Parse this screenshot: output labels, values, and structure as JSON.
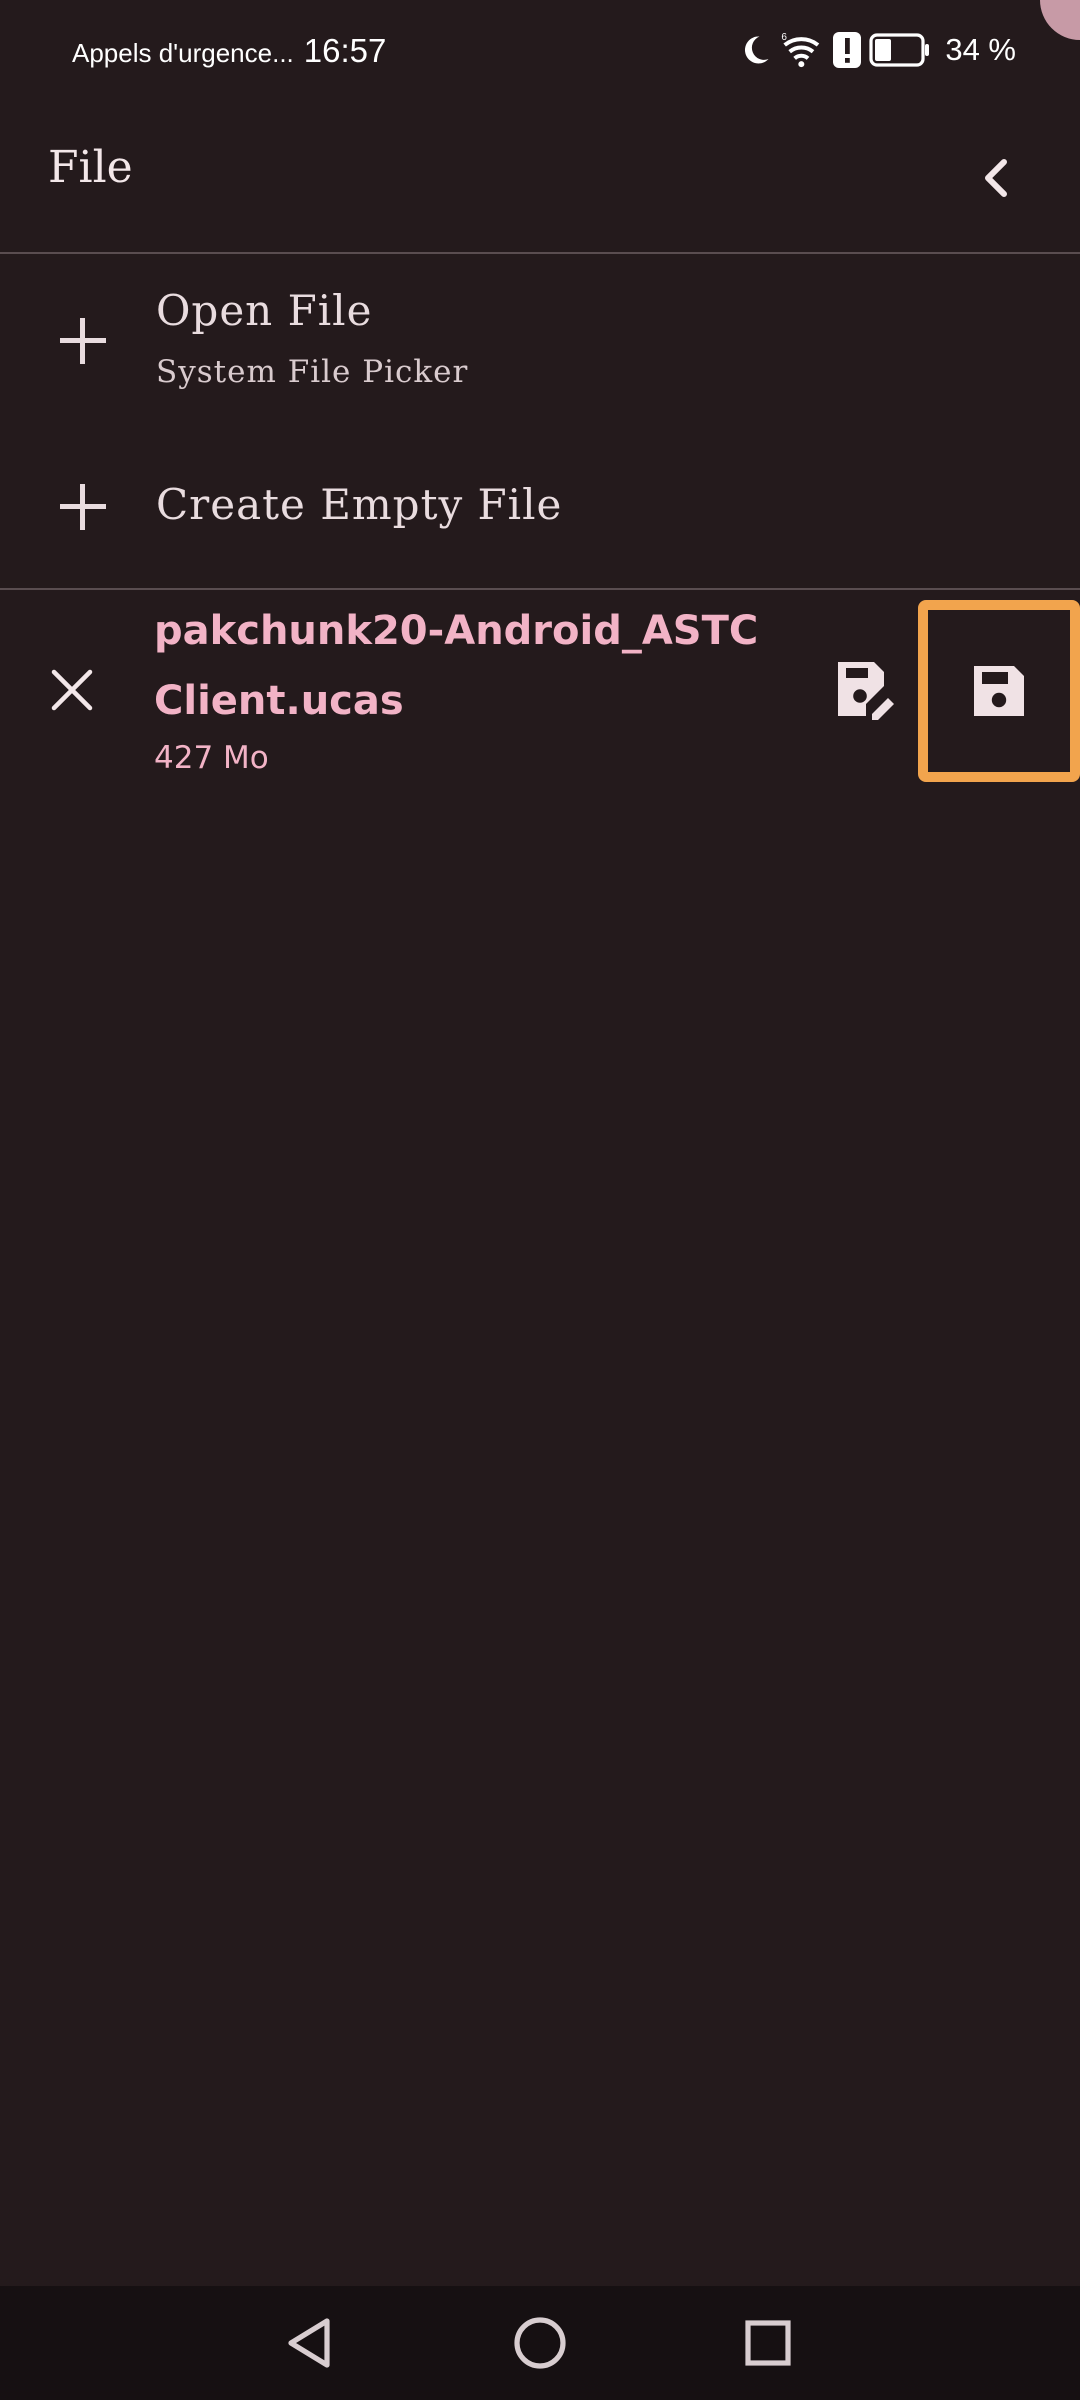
{
  "status_bar": {
    "carrier_text": "Appels d'urgence...",
    "time": "16:57",
    "battery_percent": "34 %",
    "icons": [
      "moon-icon",
      "wifi-icon",
      "alert-icon",
      "battery-icon"
    ],
    "battery_level": 0.34
  },
  "header": {
    "title": "File"
  },
  "menu": {
    "open_file": {
      "label": "Open File",
      "sublabel": "System File Picker"
    },
    "create_empty": {
      "label": "Create Empty File"
    }
  },
  "file": {
    "name": "pakchunk20-Android_ASTCClient.ucas",
    "size": "427 Mo"
  },
  "colors": {
    "background": "#241a1c",
    "accent_pink": "#f2b3c6",
    "highlight_orange": "#f2a44d",
    "text": "#efe3e5"
  }
}
